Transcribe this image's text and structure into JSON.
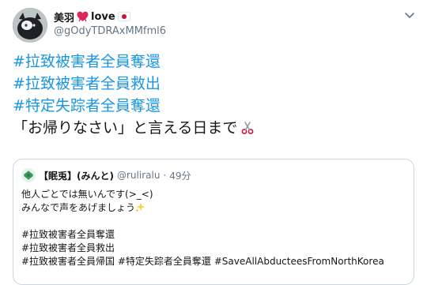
{
  "author": {
    "display_name": "美羽",
    "display_name_suffix": "love",
    "handle": "@gOdyTDRAxMMfml6",
    "heart_icon": "heart-ribbon-icon",
    "flag_icon": "japan-flag-icon",
    "menu_icon": "chevron-down-icon"
  },
  "tweet": {
    "hashtags": [
      "#拉致被害者全員奪還",
      "#拉致被害者全員救出",
      "#特定失踪者全員奪還"
    ],
    "text": "「お帰りなさい」と言える日まで",
    "trailing_emoji": "scissors-icon"
  },
  "quoted": {
    "display_name": "【眠兎】(みんと)",
    "handle": "@ruliralu",
    "separator": "·",
    "time": "49分",
    "lines": [
      "他人ごとでは無いんです(>_<)",
      "みんなで声をあげましょう",
      "",
      "#拉致被害者全員奪還",
      "#拉致被害者全員救出",
      "#拉致被害者全員帰国 #特定失踪者全員奪還 #SaveAllAbducteesFromNorthKorea"
    ],
    "sparkle_icon": "sparkles-icon"
  },
  "colors": {
    "link": "#1b95e0",
    "text": "#14171a",
    "secondary": "#657786",
    "border": "#ccd6dd"
  }
}
